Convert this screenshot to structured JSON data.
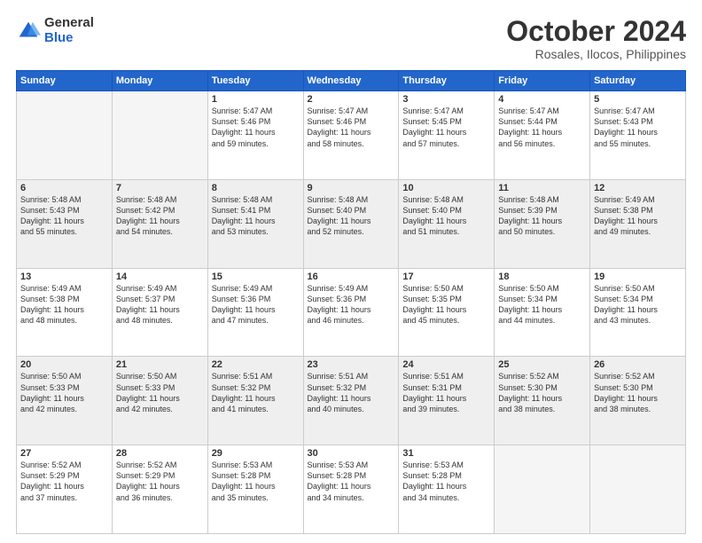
{
  "header": {
    "logo_general": "General",
    "logo_blue": "Blue",
    "month_title": "October 2024",
    "subtitle": "Rosales, Ilocos, Philippines"
  },
  "days_of_week": [
    "Sunday",
    "Monday",
    "Tuesday",
    "Wednesday",
    "Thursday",
    "Friday",
    "Saturday"
  ],
  "weeks": [
    {
      "shaded": false,
      "days": [
        {
          "num": "",
          "info": ""
        },
        {
          "num": "",
          "info": ""
        },
        {
          "num": "1",
          "info": "Sunrise: 5:47 AM\nSunset: 5:46 PM\nDaylight: 11 hours\nand 59 minutes."
        },
        {
          "num": "2",
          "info": "Sunrise: 5:47 AM\nSunset: 5:46 PM\nDaylight: 11 hours\nand 58 minutes."
        },
        {
          "num": "3",
          "info": "Sunrise: 5:47 AM\nSunset: 5:45 PM\nDaylight: 11 hours\nand 57 minutes."
        },
        {
          "num": "4",
          "info": "Sunrise: 5:47 AM\nSunset: 5:44 PM\nDaylight: 11 hours\nand 56 minutes."
        },
        {
          "num": "5",
          "info": "Sunrise: 5:47 AM\nSunset: 5:43 PM\nDaylight: 11 hours\nand 55 minutes."
        }
      ]
    },
    {
      "shaded": true,
      "days": [
        {
          "num": "6",
          "info": "Sunrise: 5:48 AM\nSunset: 5:43 PM\nDaylight: 11 hours\nand 55 minutes."
        },
        {
          "num": "7",
          "info": "Sunrise: 5:48 AM\nSunset: 5:42 PM\nDaylight: 11 hours\nand 54 minutes."
        },
        {
          "num": "8",
          "info": "Sunrise: 5:48 AM\nSunset: 5:41 PM\nDaylight: 11 hours\nand 53 minutes."
        },
        {
          "num": "9",
          "info": "Sunrise: 5:48 AM\nSunset: 5:40 PM\nDaylight: 11 hours\nand 52 minutes."
        },
        {
          "num": "10",
          "info": "Sunrise: 5:48 AM\nSunset: 5:40 PM\nDaylight: 11 hours\nand 51 minutes."
        },
        {
          "num": "11",
          "info": "Sunrise: 5:48 AM\nSunset: 5:39 PM\nDaylight: 11 hours\nand 50 minutes."
        },
        {
          "num": "12",
          "info": "Sunrise: 5:49 AM\nSunset: 5:38 PM\nDaylight: 11 hours\nand 49 minutes."
        }
      ]
    },
    {
      "shaded": false,
      "days": [
        {
          "num": "13",
          "info": "Sunrise: 5:49 AM\nSunset: 5:38 PM\nDaylight: 11 hours\nand 48 minutes."
        },
        {
          "num": "14",
          "info": "Sunrise: 5:49 AM\nSunset: 5:37 PM\nDaylight: 11 hours\nand 48 minutes."
        },
        {
          "num": "15",
          "info": "Sunrise: 5:49 AM\nSunset: 5:36 PM\nDaylight: 11 hours\nand 47 minutes."
        },
        {
          "num": "16",
          "info": "Sunrise: 5:49 AM\nSunset: 5:36 PM\nDaylight: 11 hours\nand 46 minutes."
        },
        {
          "num": "17",
          "info": "Sunrise: 5:50 AM\nSunset: 5:35 PM\nDaylight: 11 hours\nand 45 minutes."
        },
        {
          "num": "18",
          "info": "Sunrise: 5:50 AM\nSunset: 5:34 PM\nDaylight: 11 hours\nand 44 minutes."
        },
        {
          "num": "19",
          "info": "Sunrise: 5:50 AM\nSunset: 5:34 PM\nDaylight: 11 hours\nand 43 minutes."
        }
      ]
    },
    {
      "shaded": true,
      "days": [
        {
          "num": "20",
          "info": "Sunrise: 5:50 AM\nSunset: 5:33 PM\nDaylight: 11 hours\nand 42 minutes."
        },
        {
          "num": "21",
          "info": "Sunrise: 5:50 AM\nSunset: 5:33 PM\nDaylight: 11 hours\nand 42 minutes."
        },
        {
          "num": "22",
          "info": "Sunrise: 5:51 AM\nSunset: 5:32 PM\nDaylight: 11 hours\nand 41 minutes."
        },
        {
          "num": "23",
          "info": "Sunrise: 5:51 AM\nSunset: 5:32 PM\nDaylight: 11 hours\nand 40 minutes."
        },
        {
          "num": "24",
          "info": "Sunrise: 5:51 AM\nSunset: 5:31 PM\nDaylight: 11 hours\nand 39 minutes."
        },
        {
          "num": "25",
          "info": "Sunrise: 5:52 AM\nSunset: 5:30 PM\nDaylight: 11 hours\nand 38 minutes."
        },
        {
          "num": "26",
          "info": "Sunrise: 5:52 AM\nSunset: 5:30 PM\nDaylight: 11 hours\nand 38 minutes."
        }
      ]
    },
    {
      "shaded": false,
      "days": [
        {
          "num": "27",
          "info": "Sunrise: 5:52 AM\nSunset: 5:29 PM\nDaylight: 11 hours\nand 37 minutes."
        },
        {
          "num": "28",
          "info": "Sunrise: 5:52 AM\nSunset: 5:29 PM\nDaylight: 11 hours\nand 36 minutes."
        },
        {
          "num": "29",
          "info": "Sunrise: 5:53 AM\nSunset: 5:28 PM\nDaylight: 11 hours\nand 35 minutes."
        },
        {
          "num": "30",
          "info": "Sunrise: 5:53 AM\nSunset: 5:28 PM\nDaylight: 11 hours\nand 34 minutes."
        },
        {
          "num": "31",
          "info": "Sunrise: 5:53 AM\nSunset: 5:28 PM\nDaylight: 11 hours\nand 34 minutes."
        },
        {
          "num": "",
          "info": ""
        },
        {
          "num": "",
          "info": ""
        }
      ]
    }
  ]
}
